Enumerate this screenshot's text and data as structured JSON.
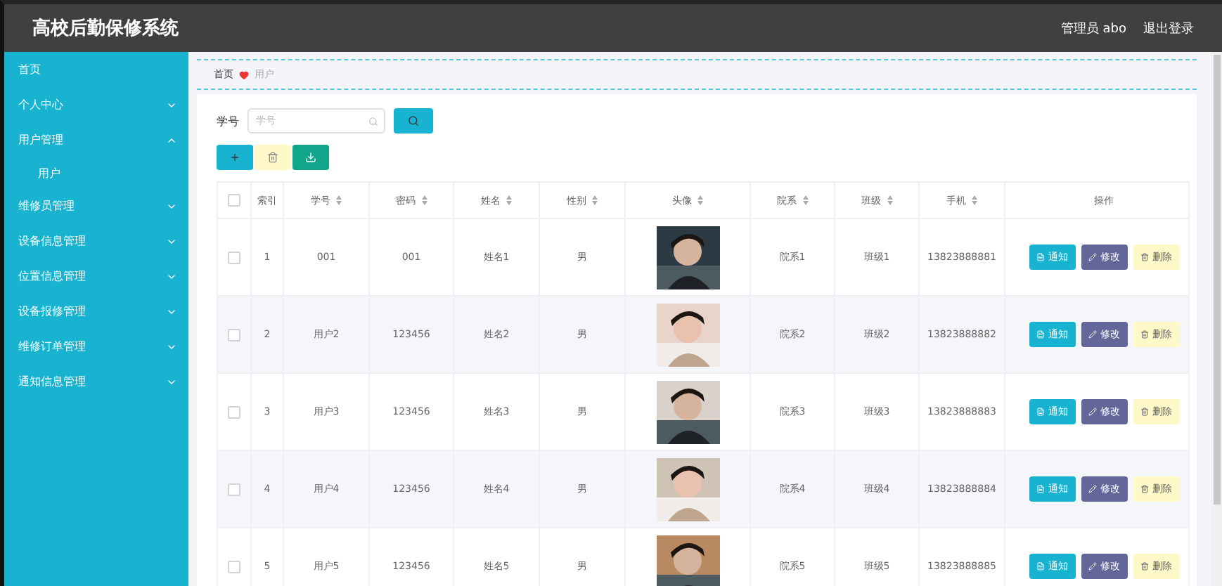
{
  "header": {
    "title": "高校后勤保修系统",
    "user": "管理员 abo",
    "logout": "退出登录"
  },
  "sidebar": {
    "items": [
      {
        "label": "首页",
        "kind": "link"
      },
      {
        "label": "个人中心",
        "kind": "menu",
        "expanded": false
      },
      {
        "label": "用户管理",
        "kind": "menu",
        "expanded": true,
        "children": [
          {
            "label": "用户"
          }
        ]
      },
      {
        "label": "维修员管理",
        "kind": "menu",
        "expanded": false
      },
      {
        "label": "设备信息管理",
        "kind": "menu",
        "expanded": false
      },
      {
        "label": "位置信息管理",
        "kind": "menu",
        "expanded": false
      },
      {
        "label": "设备报修管理",
        "kind": "menu",
        "expanded": false
      },
      {
        "label": "维修订单管理",
        "kind": "menu",
        "expanded": false
      },
      {
        "label": "通知信息管理",
        "kind": "menu",
        "expanded": false
      }
    ]
  },
  "breadcrumb": {
    "home": "首页",
    "current": "用户"
  },
  "search": {
    "label": "学号",
    "placeholder": "学号"
  },
  "table": {
    "all_checked": false,
    "columns": [
      {
        "label": "索引",
        "sortable": false
      },
      {
        "label": "学号",
        "sortable": true
      },
      {
        "label": "密码",
        "sortable": true
      },
      {
        "label": "姓名",
        "sortable": true
      },
      {
        "label": "性别",
        "sortable": true
      },
      {
        "label": "头像",
        "sortable": true
      },
      {
        "label": "院系",
        "sortable": true
      },
      {
        "label": "班级",
        "sortable": true
      },
      {
        "label": "手机",
        "sortable": true
      },
      {
        "label": "操作",
        "sortable": false
      }
    ],
    "rows": [
      {
        "checked": false,
        "cells": [
          "1",
          "001",
          "001",
          "姓名1",
          "男",
          "",
          "院系1",
          "班级1",
          "13823888881"
        ],
        "actions": [
          "通知",
          "修改",
          "删除"
        ]
      },
      {
        "checked": false,
        "cells": [
          "2",
          "用户2",
          "123456",
          "姓名2",
          "男",
          "",
          "院系2",
          "班级2",
          "13823888882"
        ],
        "actions": [
          "通知",
          "修改",
          "删除"
        ]
      },
      {
        "checked": false,
        "cells": [
          "3",
          "用户3",
          "123456",
          "姓名3",
          "男",
          "",
          "院系3",
          "班级3",
          "13823888883"
        ],
        "actions": [
          "通知",
          "修改",
          "删除"
        ]
      },
      {
        "checked": false,
        "cells": [
          "4",
          "用户4",
          "123456",
          "姓名4",
          "男",
          "",
          "院系4",
          "班级4",
          "13823888884"
        ],
        "actions": [
          "通知",
          "修改",
          "删除"
        ]
      },
      {
        "checked": false,
        "cells": [
          "5",
          "用户5",
          "123456",
          "姓名5",
          "男",
          "",
          "院系5",
          "班级5",
          "13823888885"
        ],
        "actions": [
          "通知",
          "修改",
          "删除"
        ]
      }
    ]
  }
}
